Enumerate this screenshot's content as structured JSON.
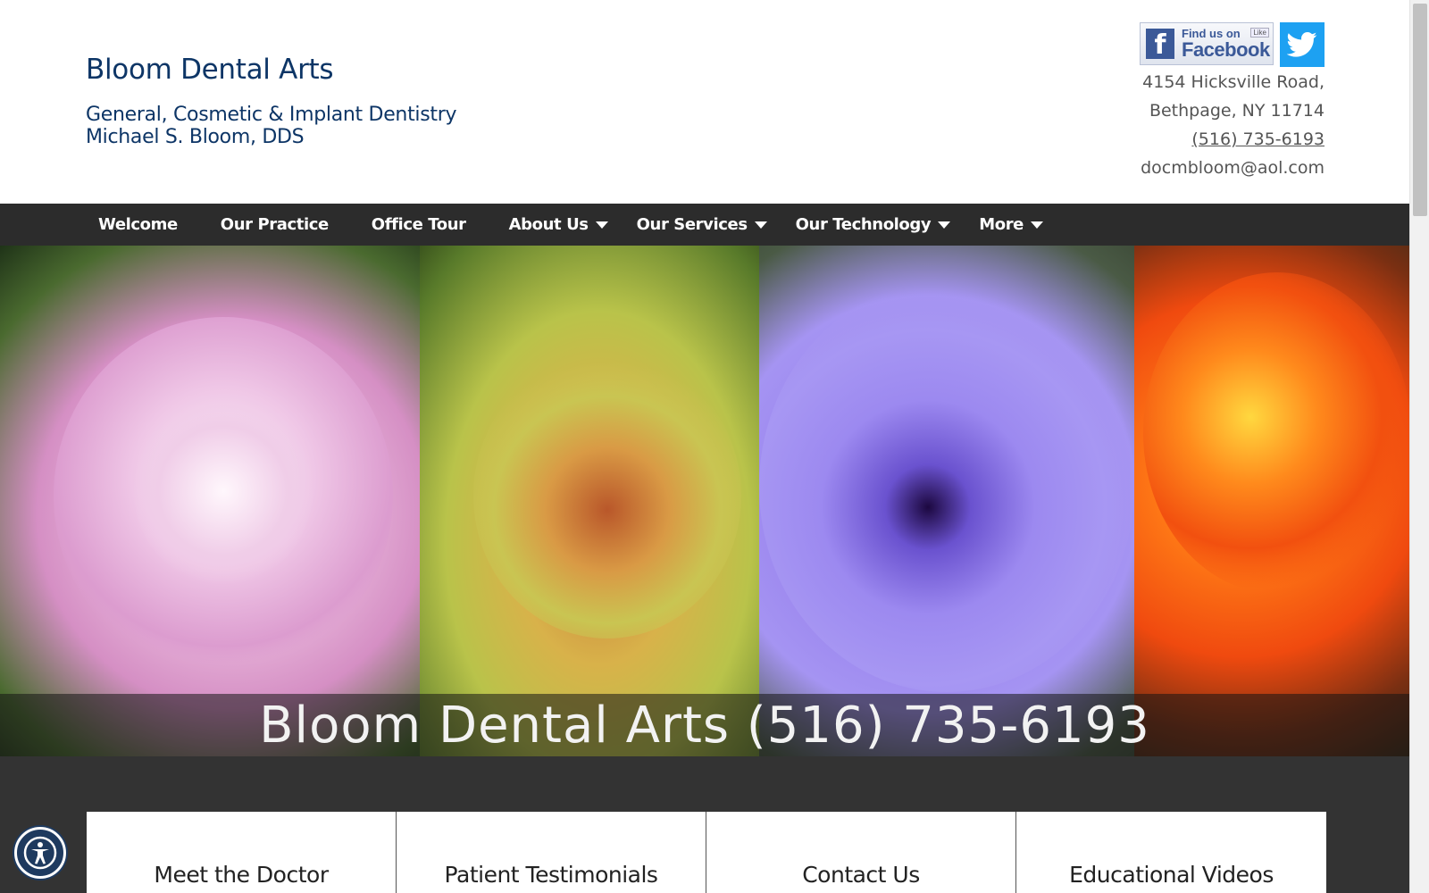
{
  "header": {
    "title": "Bloom Dental Arts",
    "tagline_line1": "General, Cosmetic & Implant Dentistry",
    "tagline_line2": "Michael S. Bloom, DDS"
  },
  "social": {
    "facebook_small": "Find us on",
    "facebook_big": "Facebook",
    "facebook_like": "Like",
    "facebook_color": "#3b5998",
    "twitter_color": "#1da1f2"
  },
  "contact": {
    "address_line1": "4154 Hicksville Road,",
    "address_line2": "Bethpage, NY 11714",
    "phone": "(516) 735-6193",
    "email": "docmbloom@aol.com"
  },
  "nav": {
    "items": [
      {
        "label": "Welcome",
        "dropdown": false
      },
      {
        "label": "Our Practice",
        "dropdown": false
      },
      {
        "label": "Office Tour",
        "dropdown": false
      },
      {
        "label": "About Us",
        "dropdown": true
      },
      {
        "label": "Our Services",
        "dropdown": true
      },
      {
        "label": "Our Technology",
        "dropdown": true
      },
      {
        "label": "More",
        "dropdown": true
      }
    ]
  },
  "hero": {
    "banner_text": "Bloom Dental Arts (516) 735-6193"
  },
  "cards": [
    {
      "label": "Meet the Doctor"
    },
    {
      "label": "Patient Testimonials"
    },
    {
      "label": "Contact Us"
    },
    {
      "label": "Educational Videos"
    }
  ],
  "colors": {
    "brand_navy": "#0d3566",
    "nav_bg": "#2c2c2c",
    "content_bg": "#333333"
  },
  "icons": {
    "accessibility": "accessibility-icon",
    "caret": "caret-down-icon"
  }
}
